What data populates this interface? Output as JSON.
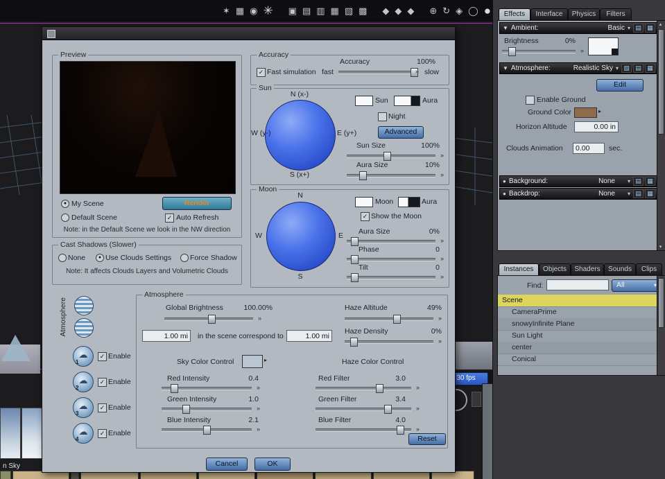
{
  "icons": {
    "disclosure": "▼",
    "dropdown": "▾",
    "bullet": "●",
    "slider_arrows": "»",
    "cloud": "☁",
    "scroll_up": "▴",
    "scroll_down": "▾",
    "swatch_arrow": "▸",
    "preset_a": "▤",
    "preset_b": "▦",
    "preset_c": "▧",
    "toolbar": {
      "light": "✶",
      "panels": "▦",
      "display": "◉",
      "snowflake": "✳",
      "layout_1": "▣",
      "layout_2": "▤",
      "layout_3": "▥",
      "layout_4": "▦",
      "layout_5": "▧",
      "layout_6": "▩",
      "shield_1": "◆",
      "shield_2": "◆",
      "shield_3": "◆",
      "target": "⊕",
      "rotate": "↻",
      "gem": "◈",
      "ring": "◯",
      "sphere": "●"
    }
  },
  "viewport": {
    "fps": "30 fps",
    "caption": "n Sky"
  },
  "dialog": {
    "preview": {
      "label": "Preview",
      "my_scene": {
        "label": "My Scene",
        "dot": "●"
      },
      "default_scene": {
        "label": "Default Scene",
        "dot": ""
      },
      "render_button": "Render",
      "auto_refresh": {
        "label": "Auto Refresh",
        "check": "✓"
      },
      "note": "Note: in the Default Scene we look in the NW direction"
    },
    "cast_shadows": {
      "label": "Cast Shadows (Slower)",
      "options": [
        {
          "label": "None",
          "dot": ""
        },
        {
          "label": "Use Clouds Settings",
          "dot": "●"
        },
        {
          "label": "Force Shadow",
          "dot": ""
        }
      ],
      "note": "Note: It affects Clouds Layers and Volumetric Clouds"
    },
    "accuracy": {
      "label": "Accuracy",
      "fast_simulation": {
        "label": "Fast simulation",
        "check": "✓"
      },
      "accuracy_label": "Accuracy",
      "value": "100%",
      "fast": "fast",
      "slow": "slow",
      "handle_left": "90%"
    },
    "sun": {
      "label": "Sun",
      "compass": {
        "n": "N (x-)",
        "w": "W (y-)",
        "e": "E (y+)",
        "s": "S (x+)"
      },
      "sun_swatch_label": "Sun",
      "aura_swatch_label": "Aura",
      "night": {
        "label": "Night",
        "check": ""
      },
      "advanced_button": "Advanced",
      "sun_size": {
        "label": "Sun Size",
        "value": "100%",
        "handle_left": "38%"
      },
      "aura_size": {
        "label": "Aura Size",
        "value": "10%",
        "handle_left": "13%"
      }
    },
    "moon": {
      "label": "Moon",
      "compass": {
        "n": "N",
        "w": "W",
        "e": "E",
        "s": "S"
      },
      "moon_swatch_label": "Moon",
      "aura_swatch_label": "Aura",
      "show_moon": {
        "label": "Show the Moon",
        "check": "✓"
      },
      "aura_size": {
        "label": "Aura Size",
        "value": "0%",
        "handle_left": "4%"
      },
      "phase": {
        "label": "Phase",
        "value": "0",
        "handle_left": "4%"
      },
      "tilt": {
        "label": "Tilt",
        "value": "0",
        "handle_left": "4%"
      }
    },
    "atmosphere": {
      "label": "Atmosphere",
      "side_label": "Atmosphere",
      "layers": [
        {
          "num": "1",
          "enable": "Enable",
          "check": "✓"
        },
        {
          "num": "2",
          "enable": "Enable",
          "check": "✓"
        },
        {
          "num": "3",
          "enable": "Enable",
          "check": "✓"
        },
        {
          "num": "4",
          "enable": "Enable",
          "check": "✓"
        }
      ],
      "global_brightness": {
        "label": "Global Brightness",
        "value": "100.00%",
        "handle_left": "45%"
      },
      "scale_from": "1.00 mi",
      "scale_text": "in the scene correspond to",
      "scale_to": "1.00 mi",
      "haze_altitude": {
        "label": "Haze Altitude",
        "value": "49%",
        "handle_left": "50%"
      },
      "haze_density": {
        "label": "Haze Density",
        "value": "0%",
        "handle_left": "6%"
      },
      "sky_color_label": "Sky Color Control",
      "haze_color_label": "Haze Color Control",
      "intensity": [
        {
          "label": "Red Intensity",
          "value": "0.4",
          "handle_left": "9%"
        },
        {
          "label": "Green Intensity",
          "value": "1.0",
          "handle_left": "21%"
        },
        {
          "label": "Blue Intensity",
          "value": "2.1",
          "handle_left": "42%"
        }
      ],
      "filter": [
        {
          "label": "Red Filter",
          "value": "3.0",
          "handle_left": "58%"
        },
        {
          "label": "Green Filter",
          "value": "3.4",
          "handle_left": "66%"
        },
        {
          "label": "Blue Filter",
          "value": "4.0",
          "handle_left": "78%"
        }
      ],
      "reset_button": "Reset"
    },
    "cancel_button": "Cancel",
    "ok_button": "OK"
  },
  "effects_panel": {
    "tabs": [
      "Effects",
      "Interface",
      "Physics",
      "Filters"
    ],
    "ambient": {
      "header": "Ambient:",
      "mode": "Basic",
      "brightness_label": "Brightness",
      "brightness_value": "0%",
      "handle_left": "8%"
    },
    "atmosphere": {
      "header": "Atmosphere:",
      "mode": "Realistic Sky",
      "edit_button": "Edit",
      "enable_ground": {
        "label": "Enable Ground",
        "check": ""
      },
      "ground_color_label": "Ground Color",
      "horizon_altitude_label": "Horizon Altitude",
      "horizon_altitude_value": "0.00 in",
      "clouds_animation_label": "Clouds Animation",
      "clouds_animation_value": "0.00",
      "clouds_animation_unit": "sec."
    },
    "background": {
      "header": "Background:",
      "mode": "None"
    },
    "backdrop": {
      "header": "Backdrop:",
      "mode": "None"
    }
  },
  "instances_panel": {
    "tabs": [
      "Instances",
      "Objects",
      "Shaders",
      "Sounds",
      "Clips"
    ],
    "find_label": "Find:",
    "find_value": "",
    "filter_dropdown": "All",
    "scene_root": "Scene",
    "items": [
      "CameraPrime",
      "snowyInfinite Plane",
      "Sun Light",
      "center",
      "Conical"
    ]
  },
  "colors": {
    "accent_blue": "#466ea6",
    "dialog_gray": "#b2b9c0",
    "panel_gray": "#9aa3ab",
    "highlight_yellow": "#ddd55e",
    "render_orange": "#e08a28",
    "ground_brown": "#8f6b49",
    "sky_swatch": "#b9c6d2",
    "frame_magenta": "#ad35ad"
  }
}
